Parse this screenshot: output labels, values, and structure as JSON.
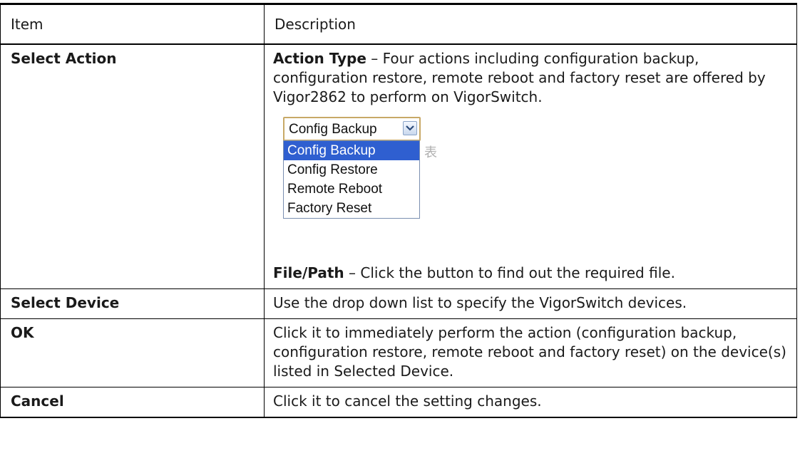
{
  "table": {
    "headers": {
      "item": "Item",
      "description": "Description"
    },
    "rows": [
      {
        "item": "Select Action",
        "paras": [
          {
            "term": "Action Type",
            "text": " – Four actions including configuration backup, configuration restore, remote reboot and factory reset are offered by Vigor2862 to perform on VigorSwitch."
          },
          {
            "term": "File/Path",
            "text": " – Click the button to find out the required file."
          }
        ]
      },
      {
        "item": "Select Device",
        "text": "Use the drop down list to specify the VigorSwitch devices."
      },
      {
        "item": "OK",
        "text": "Click it to immediately perform the action (configuration backup, configuration restore, remote reboot and factory reset) on the device(s) listed in Selected Device."
      },
      {
        "item": "Cancel",
        "text": "Click it to cancel the setting changes."
      }
    ]
  },
  "dropdown": {
    "selected": "Config Backup",
    "options": [
      "Config Backup",
      "Config Restore",
      "Remote Reboot",
      "Factory Reset"
    ],
    "ghost_glyph": "表",
    "icon": "chevron-down-icon",
    "colors": {
      "border": "#c8a967",
      "highlight": "#2f5fd0",
      "highlight_text": "#ffffff"
    }
  }
}
